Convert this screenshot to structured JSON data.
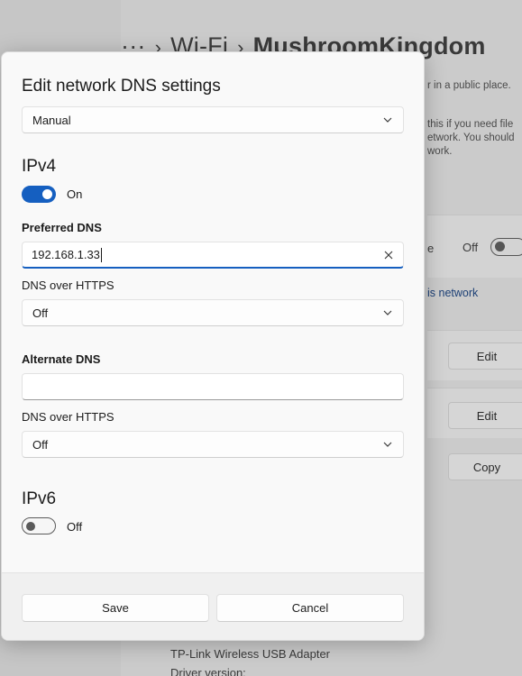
{
  "background": {
    "breadcrumb": {
      "more": "···",
      "crumb": "Wi-Fi",
      "current": "MushroomKingdom"
    },
    "public_place_text": "r in a public place.",
    "description_lines": [
      "this if you need file",
      "etwork. You should",
      "work."
    ],
    "row_letter": "e",
    "toggle_label": "Off",
    "link_text": "is network",
    "edit_label_1": "Edit",
    "edit_label_2": "Edit",
    "copy_label": "Copy",
    "adapter_text": "TP-Link Wireless USB Adapter",
    "driver_text": "Driver version:"
  },
  "dialog": {
    "title": "Edit network DNS settings",
    "mode_select": "Manual",
    "ipv4": {
      "title": "IPv4",
      "toggle_label": "On",
      "preferred_label": "Preferred DNS",
      "preferred_value": "192.168.1.33",
      "preferred_doh_label": "DNS over HTTPS",
      "preferred_doh_value": "Off",
      "alternate_label": "Alternate DNS",
      "alternate_value": "",
      "alternate_doh_label": "DNS over HTTPS",
      "alternate_doh_value": "Off"
    },
    "ipv6": {
      "title": "IPv6",
      "toggle_label": "Off"
    },
    "save_label": "Save",
    "cancel_label": "Cancel"
  },
  "colors": {
    "accent": "#155fc0",
    "dialog_bg": "#f9f9f9",
    "footer_bg": "#f0f0f0"
  }
}
